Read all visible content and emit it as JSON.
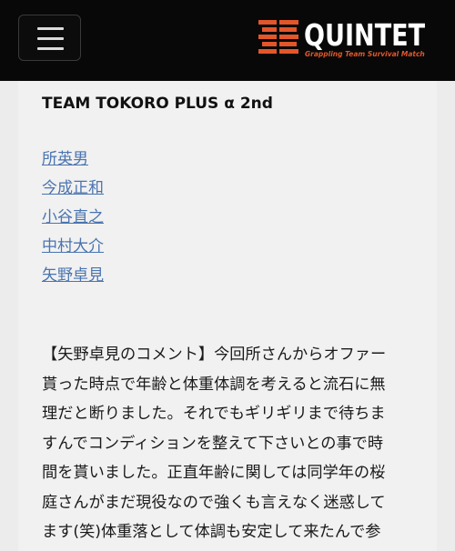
{
  "header": {
    "menu_icon": "hamburger-menu-icon",
    "logo": {
      "name": "QUINTET",
      "tagline": "Grappling Team Survival Match",
      "colors": {
        "brand_orange": "#e2562a",
        "background": "#080808"
      }
    }
  },
  "main": {
    "team_title": "TEAM TOKORO PLUS α 2nd",
    "members": [
      "所英男",
      "今成正和",
      "小谷直之",
      "中村大介",
      "矢野卓見"
    ],
    "comment_lines": [
      "【矢野卓見のコメント】今回所さんからオファー",
      "貰った時点で年齢と体重体調を考えると流石に無",
      "理だと断りました。それでもギリギリまで待ちま",
      "すんでコンディションを整えて下さいとの事で時",
      "間を貰いました。正直年齢に関しては同学年の桜",
      "庭さんがまだ現役なので強くも言えなく迷惑して",
      "ます(笑)体重落として体調も安定して来たんで参"
    ],
    "link_color": "#4a74b0"
  }
}
